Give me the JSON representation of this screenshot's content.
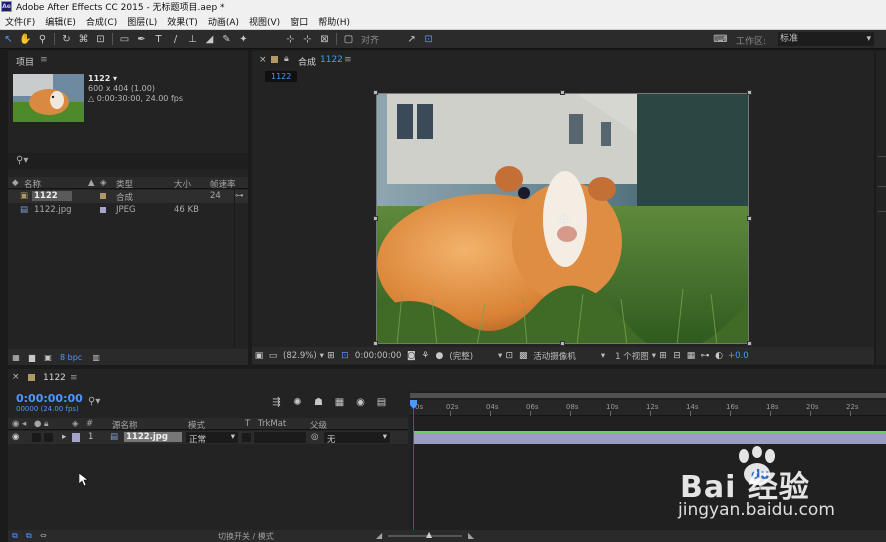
{
  "window": {
    "title": "Adobe After Effects CC 2015 - 无标题项目.aep *",
    "app_icon_text": "Ae"
  },
  "menu": [
    "文件(F)",
    "编辑(E)",
    "合成(C)",
    "图层(L)",
    "效果(T)",
    "动画(A)",
    "视图(V)",
    "窗口",
    "帮助(H)"
  ],
  "toolbar": {
    "align_label": "对齐",
    "workspace_label": "工作区:",
    "workspace_value": "标准"
  },
  "project": {
    "tab": "项目",
    "menu_icon": "≡",
    "selected_name": "1122 ▾",
    "selected_dims": "600 x 404 (1.00)",
    "selected_duration": "△ 0:00:30:00, 24.00 fps",
    "columns": {
      "name": "名称",
      "type": "类型",
      "size": "大小",
      "fps": "帧速率"
    },
    "items": [
      {
        "name": "1122",
        "type": "合成",
        "size": "",
        "fps": "24",
        "color": "#b19a66"
      },
      {
        "name": "1122.jpg",
        "type": "JPEG",
        "size": "46 KB",
        "fps": "",
        "color": "#a5a5cc"
      }
    ],
    "bpc": "8 bpc"
  },
  "composition": {
    "tab_prefix": "合成",
    "tab_name": "1122",
    "subtab": "1122",
    "zoom": "(82.9%)",
    "timecode": "0:00:00:00",
    "resolution": "(完整)",
    "camera": "活动摄像机",
    "views": "1 个视图",
    "exposure": "+0.0"
  },
  "timeline": {
    "tab": "1122",
    "timecode": "0:00:00:00",
    "frame_info": "00000 (24.00 fps)",
    "columns": {
      "num": "#",
      "source": "源名称",
      "mode": "模式",
      "t": "T",
      "trkmat": "TrkMat",
      "parent": "父级"
    },
    "layer": {
      "index": "1",
      "name": "1122.jpg",
      "mode": "正常",
      "parent": "无"
    },
    "ruler_labels": [
      "0s",
      "02s",
      "04s",
      "06s",
      "08s",
      "10s",
      "12s",
      "14s",
      "16s",
      "18s",
      "20s",
      "22s"
    ],
    "bottom_label": "切换开关 / 模式"
  },
  "watermark": {
    "logo_text": "Bai  经验",
    "url": "jingyan.baidu.com"
  }
}
